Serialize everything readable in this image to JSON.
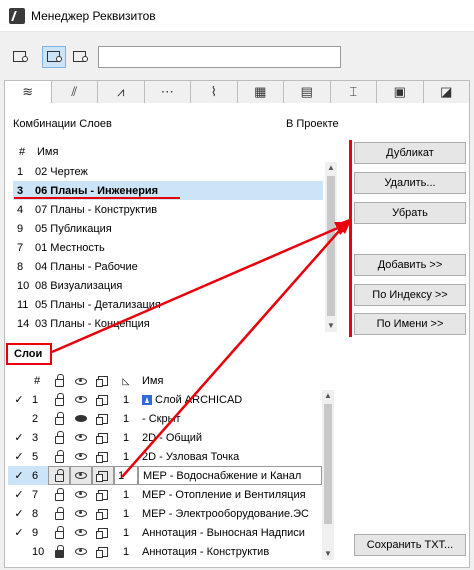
{
  "window": {
    "title": "Менеджер Реквизитов"
  },
  "tabs": [
    "layers-icon",
    "pen-icon",
    "fill-icon",
    "line-icon",
    "brush-icon",
    "building-material-icon",
    "composite-icon",
    "profile-icon",
    "zone-icon",
    "surface-icon"
  ],
  "search": {
    "value": ""
  },
  "combos": {
    "title": "Комбинации Слоев",
    "in_project": "В Проекте",
    "col_num": "#",
    "col_name": "Имя",
    "rows": [
      {
        "num": "1",
        "name": "02 Чертеж"
      },
      {
        "num": "3",
        "name": "06 Планы - Инженерия",
        "selected": true
      },
      {
        "num": "4",
        "name": "07 Планы - Конструктив"
      },
      {
        "num": "9",
        "name": "05 Публикация"
      },
      {
        "num": "7",
        "name": "01 Местность"
      },
      {
        "num": "8",
        "name": "04 Планы - Рабочие"
      },
      {
        "num": "10",
        "name": "08 Визуализация"
      },
      {
        "num": "11",
        "name": "05 Планы - Детализация"
      },
      {
        "num": "14",
        "name": "03 Планы - Концепция"
      }
    ]
  },
  "buttons": {
    "duplicate": "Дубликат",
    "delete": "Удалить...",
    "remove": "Убрать",
    "add": "Добавить >>",
    "by_index": "По Индексу >>",
    "by_name": "По Имени >>",
    "save_txt": "Сохранить TXT..."
  },
  "layers": {
    "title": "Слои",
    "col_num": "#",
    "col_name": "Имя",
    "rows": [
      {
        "check": "✓",
        "num": "1",
        "lock": "open",
        "visible": true,
        "intersect": "1",
        "name": "Слой ARCHICAD",
        "archicad": true
      },
      {
        "check": "",
        "num": "2",
        "lock": "open",
        "visible": false,
        "intersect": "1",
        "name": "- Скрыт"
      },
      {
        "check": "✓",
        "num": "3",
        "lock": "open",
        "visible": true,
        "intersect": "1",
        "name": "2D - Общий"
      },
      {
        "check": "✓",
        "num": "5",
        "lock": "open",
        "visible": true,
        "intersect": "1",
        "name": "2D - Узловая Точка"
      },
      {
        "check": "✓",
        "num": "6",
        "lock": "open",
        "visible": true,
        "intersect": "1",
        "name": "MEP - Водоснабжение и Канал",
        "selected": true
      },
      {
        "check": "✓",
        "num": "7",
        "lock": "open",
        "visible": true,
        "intersect": "1",
        "name": "MEP - Отопление и Вентиляция"
      },
      {
        "check": "✓",
        "num": "8",
        "lock": "open",
        "visible": true,
        "intersect": "1",
        "name": "MEP - Электрооборудование.ЭС"
      },
      {
        "check": "✓",
        "num": "9",
        "lock": "open",
        "visible": true,
        "intersect": "1",
        "name": "Аннотация - Выносная Надписи"
      },
      {
        "check": "",
        "num": "10",
        "lock": "closed",
        "visible": true,
        "intersect": "1",
        "name": "Аннотация - Конструктив"
      }
    ]
  },
  "colors": {
    "annotation_red": "#e8000b",
    "selection": "#cce4f7"
  }
}
